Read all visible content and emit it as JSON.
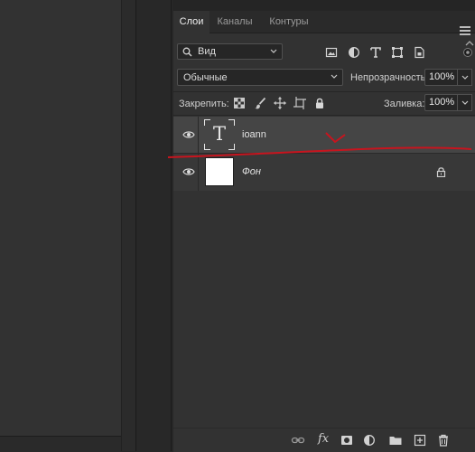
{
  "panel": {
    "tabs": [
      {
        "label": "Слои",
        "active": true
      },
      {
        "label": "Каналы",
        "active": false
      },
      {
        "label": "Контуры",
        "active": false
      }
    ]
  },
  "filter": {
    "kind_label": "Вид",
    "icons": [
      "image-filter-icon",
      "adjustment-filter-icon",
      "type-filter-icon",
      "shape-filter-icon",
      "smart-object-filter-icon"
    ]
  },
  "blend": {
    "mode": "Обычные",
    "opacity_label": "Непрозрачность:",
    "opacity_value": "100%"
  },
  "lock": {
    "label": "Закрепить:",
    "fill_label": "Заливка:",
    "fill_value": "100%"
  },
  "layers": [
    {
      "name": "ioann",
      "type": "text",
      "thumb_glyph": "T",
      "selected": true,
      "visible": true,
      "locked": false
    },
    {
      "name": "Фон",
      "type": "background",
      "selected": false,
      "visible": true,
      "locked": true
    }
  ],
  "colors": {
    "annotation": "#c8141e",
    "panel_bg": "#323232",
    "selected_layer": "#454545"
  }
}
